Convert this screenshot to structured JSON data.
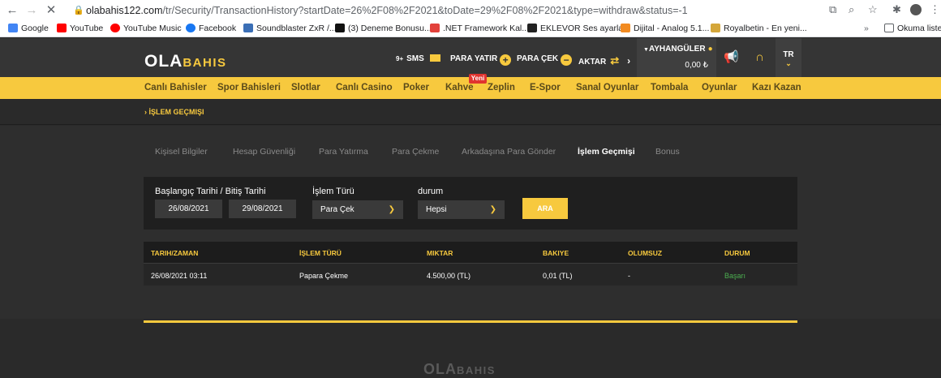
{
  "browser": {
    "url_domain": "olabahis122.com",
    "url_path": "/tr/Security/TransactionHistory?startDate=26%2F08%2F2021&toDate=29%2F08%2F2021&type=withdraw&status=-1",
    "bookmarks": [
      {
        "label": "Google",
        "color": "#4285f4"
      },
      {
        "label": "YouTube",
        "color": "#ff0000"
      },
      {
        "label": "YouTube Music",
        "color": "#ff0000"
      },
      {
        "label": "Facebook",
        "color": "#1877f2"
      },
      {
        "label": "Soundblaster ZxR /...",
        "color": "#3b6fb6"
      },
      {
        "label": "(3) Deneme Bonusu...",
        "color": "#111111"
      },
      {
        "label": ".NET Framework Kal...",
        "color": "#e2413b"
      },
      {
        "label": "EKLEVOR Ses ayarla...",
        "color": "#222222"
      },
      {
        "label": "Dijital - Analog 5.1...",
        "color": "#f28b21"
      },
      {
        "label": "Royalbetin - En yeni...",
        "color": "#d4a63a"
      }
    ],
    "reading_list": "Okuma listes"
  },
  "header": {
    "logo_ola": "OLA",
    "logo_bahis": "BAHIS",
    "sms_count": "9+",
    "sms": "SMS",
    "deposit": "PARA YATIR",
    "withdraw": "PARA ÇEK",
    "transfer": "AKTAR",
    "username": "AYHANGÜLER",
    "balance": "0,00 ₺",
    "lang": "TR"
  },
  "categories": [
    "Canlı Bahisler",
    "Spor Bahisleri",
    "Slotlar",
    "Canlı Casino",
    "Poker",
    "Kahve",
    "Zeplin",
    "E-Spor",
    "Sanal Oyunlar",
    "Tombala",
    "Oyunlar",
    "Kazı Kazan"
  ],
  "new_badge": "Yeni",
  "breadcrumb": "› İŞLEM GEÇMIŞI",
  "tabs": [
    "Kişisel Bilgiler",
    "Hesap Güvenliği",
    "Para Yatırma",
    "Para Çekme",
    "Arkadaşına Para Gönder",
    "İşlem Geçmişi",
    "Bonus"
  ],
  "filters": {
    "date_label": "Başlangıç Tarihi / Bitiş Tarihi",
    "start_date": "26/08/2021",
    "end_date": "29/08/2021",
    "type_label": "İşlem Türü",
    "type_value": "Para Çek",
    "status_label": "durum",
    "status_value": "Hepsi",
    "search_button": "ARA"
  },
  "table": {
    "columns": [
      "TARIH/ZAMAN",
      "İŞLEM TÜRÜ",
      "MIKTAR",
      "BAKIYE",
      "OLUMSUZ",
      "DURUM"
    ],
    "rows": [
      [
        "26/08/2021 03:11",
        "Papara Çekme",
        "4.500,00 (TL)",
        "0,01 (TL)",
        "-",
        "Başarı"
      ]
    ]
  },
  "footer": {
    "logo_ola": "OLA",
    "logo_bahis": "BAHIS"
  },
  "colors": {
    "accent": "#f7c93e",
    "success": "#4caf50",
    "badge": "#e0342f"
  }
}
